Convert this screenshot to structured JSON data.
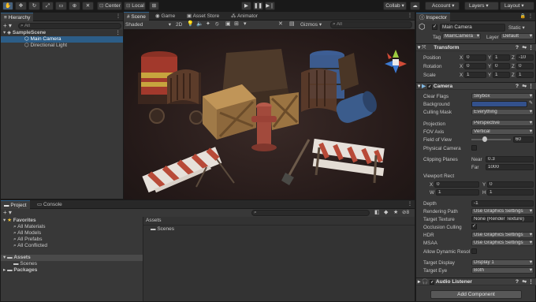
{
  "toolbar": {
    "tools": [
      "hand-tool",
      "move-tool",
      "rotate-tool",
      "scale-tool",
      "rect-tool",
      "transform-tool",
      "custom-tool"
    ],
    "pivot_label": "Center",
    "space_label": "Local",
    "collab_label": "Collab",
    "account_label": "Account",
    "layers_label": "Layers",
    "layout_label": "Layout"
  },
  "hierarchy": {
    "tab": "Hierarchy",
    "search_placeholder": "All",
    "scene": "SampleScene",
    "items": [
      "Main Camera",
      "Directional Light"
    ]
  },
  "scene_view": {
    "tabs": [
      "Scene",
      "Game",
      "Asset Store",
      "Animator"
    ],
    "shading": "Shaded",
    "mode_2d": "2D",
    "gizmos": "Gizmos",
    "search_placeholder": "All"
  },
  "project": {
    "tabs": [
      "Project",
      "Console"
    ],
    "favorites_label": "Favorites",
    "favorites": [
      "All Materials",
      "All Models",
      "All Prefabs",
      "All Conflicted"
    ],
    "assets_label": "Assets",
    "asset_children": [
      "Scenes"
    ],
    "packages_label": "Packages",
    "breadcrumb": "Assets",
    "folder_items": [
      "Scenes"
    ],
    "hidden_count": "8"
  },
  "inspector": {
    "tab": "Inspector",
    "object_name": "Main Camera",
    "static_label": "Static",
    "tag_label": "Tag",
    "tag_value": "MainCamera",
    "layer_label": "Layer",
    "layer_value": "Default",
    "transform": {
      "title": "Transform",
      "position_label": "Position",
      "rotation_label": "Rotation",
      "scale_label": "Scale",
      "position": [
        "0",
        "1",
        "-10"
      ],
      "rotation": [
        "0",
        "0",
        "0"
      ],
      "scale": [
        "1",
        "1",
        "1"
      ]
    },
    "camera": {
      "title": "Camera",
      "clear_flags_label": "Clear Flags",
      "clear_flags": "Skybox",
      "background_label": "Background",
      "background_color": "#33518c",
      "culling_mask_label": "Culling Mask",
      "culling_mask": "Everything",
      "projection_label": "Projection",
      "projection": "Perspective",
      "fov_axis_label": "FOV Axis",
      "fov_axis": "Vertical",
      "fov_label": "Field of View",
      "fov": "60",
      "fov_fraction": 0.33,
      "physical_label": "Physical Camera",
      "clipping_label": "Clipping Planes",
      "near_label": "Near",
      "near": "0.3",
      "far_label": "Far",
      "far": "1000",
      "viewport_label": "Viewport Rect",
      "viewport": {
        "x": "0",
        "y": "0",
        "w": "1",
        "h": "1"
      },
      "depth_label": "Depth",
      "depth": "-1",
      "rendering_path_label": "Rendering Path",
      "rendering_path": "Use Graphics Settings",
      "target_texture_label": "Target Texture",
      "target_texture": "None (Render Texture)",
      "occlusion_label": "Occlusion Culling",
      "hdr_label": "HDR",
      "hdr": "Use Graphics Settings",
      "msaa_label": "MSAA",
      "msaa": "Use Graphics Settings",
      "dynamic_res_label": "Allow Dynamic Resol",
      "target_display_label": "Target Display",
      "target_display": "Display 1",
      "target_eye_label": "Target Eye",
      "target_eye": "Both"
    },
    "audio_listener_title": "Audio Listener",
    "add_component": "Add Component"
  },
  "colors": {
    "accent": "#2c5d87",
    "panel": "#383838",
    "scene_bg": "#2f2220"
  }
}
